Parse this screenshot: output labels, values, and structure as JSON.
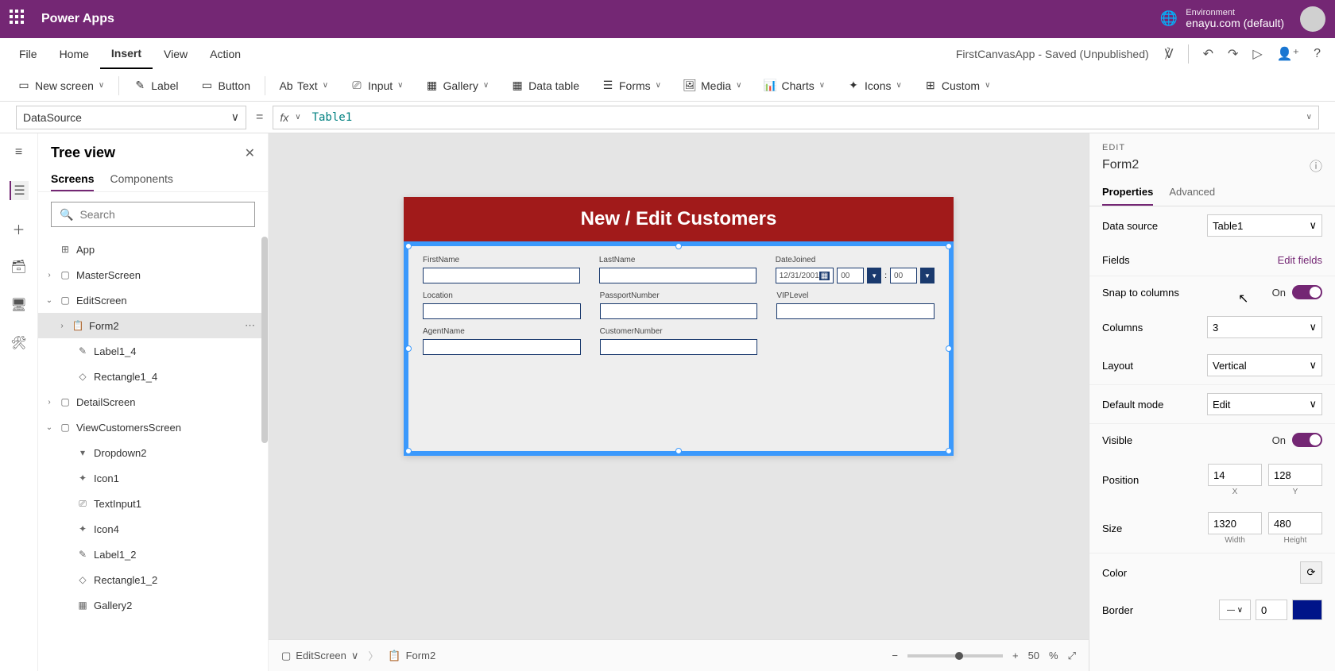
{
  "topbar": {
    "title": "Power Apps",
    "env_label": "Environment",
    "env_name": "enayu.com (default)"
  },
  "menu": {
    "items": [
      "File",
      "Home",
      "Insert",
      "View",
      "Action"
    ],
    "active": "Insert",
    "status": "FirstCanvasApp - Saved (Unpublished)"
  },
  "ribbon": {
    "new_screen": "New screen",
    "label": "Label",
    "button": "Button",
    "text": "Text",
    "input": "Input",
    "gallery": "Gallery",
    "data_table": "Data table",
    "forms": "Forms",
    "media": "Media",
    "charts": "Charts",
    "icons": "Icons",
    "custom": "Custom"
  },
  "formula": {
    "property": "DataSource",
    "value": "Table1"
  },
  "tree": {
    "title": "Tree view",
    "tabs": {
      "screens": "Screens",
      "components": "Components"
    },
    "search": "Search",
    "nodes": {
      "app": "App",
      "master": "MasterScreen",
      "edit": "EditScreen",
      "form2": "Form2",
      "label14": "Label1_4",
      "rect14": "Rectangle1_4",
      "detail": "DetailScreen",
      "view": "ViewCustomersScreen",
      "dropdown2": "Dropdown2",
      "icon1": "Icon1",
      "textinput1": "TextInput1",
      "icon4": "Icon4",
      "label12": "Label1_2",
      "rect12": "Rectangle1_2",
      "gallery2": "Gallery2"
    }
  },
  "preview": {
    "header": "New / Edit Customers",
    "fields": {
      "firstname": "FirstName",
      "lastname": "LastName",
      "datejoined": "DateJoined",
      "date_value": "12/31/2001",
      "hh": "00",
      "mm": "00",
      "location": "Location",
      "passport": "PassportNumber",
      "vip": "VIPLevel",
      "agent": "AgentName",
      "custnum": "CustomerNumber"
    }
  },
  "properties": {
    "context": "EDIT",
    "name": "Form2",
    "tabs": {
      "properties": "Properties",
      "advanced": "Advanced"
    },
    "ds_label": "Data source",
    "ds_value": "Table1",
    "fields_label": "Fields",
    "fields_link": "Edit fields",
    "snap_label": "Snap to columns",
    "snap_on": "On",
    "cols_label": "Columns",
    "cols_value": "3",
    "layout_label": "Layout",
    "layout_value": "Vertical",
    "defmode_label": "Default mode",
    "defmode_value": "Edit",
    "visible_label": "Visible",
    "visible_on": "On",
    "pos_label": "Position",
    "pos_x": "14",
    "pos_y": "128",
    "x_l": "X",
    "y_l": "Y",
    "size_label": "Size",
    "size_w": "1320",
    "size_h": "480",
    "w_l": "Width",
    "h_l": "Height",
    "color_label": "Color",
    "border_label": "Border",
    "border_num": "0"
  },
  "footer": {
    "bc_screen": "EditScreen",
    "bc_form": "Form2",
    "zoom": "50",
    "pct": "%"
  }
}
